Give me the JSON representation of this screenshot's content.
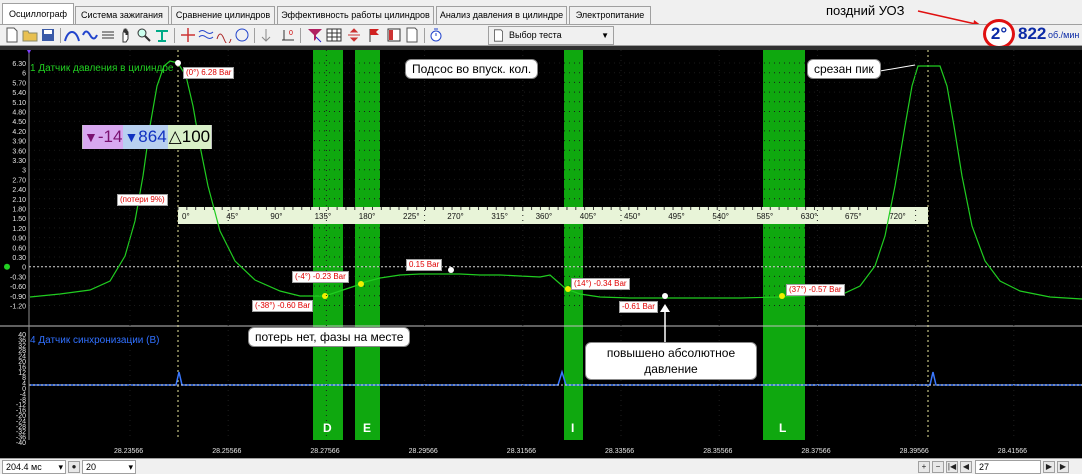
{
  "tabs": [
    {
      "label": "Осциллограф",
      "active": true
    },
    {
      "label": "Система зажигания",
      "active": false
    },
    {
      "label": "Сравнение цилиндров",
      "active": false
    },
    {
      "label": "Эффективность работы цилиндров",
      "active": false
    },
    {
      "label": "Анализ давления в цилиндре",
      "active": false
    },
    {
      "label": "Электропитание",
      "active": false
    }
  ],
  "annotation_top": "поздний УОЗ",
  "toolbar": {
    "test_select": "Выбор теста",
    "ignition_angle": "2°",
    "rpm_value": "822",
    "rpm_unit": "об./мин"
  },
  "channel1": {
    "title": "1 Датчик давления в цилиндре",
    "color": "#22d022",
    "y_ticks": [
      "6.30",
      "6",
      "5.70",
      "5.40",
      "5.10",
      "4.80",
      "4.50",
      "4.20",
      "3.90",
      "3.60",
      "3.30",
      "3",
      "2.70",
      "2.40",
      "2.10",
      "1.80",
      "1.50",
      "1.20",
      "0.90",
      "0.60",
      "0.30",
      "0",
      "-0.30",
      "-0.60",
      "-0.90",
      "-1.20"
    ]
  },
  "channel4": {
    "title": "4 Датчик синхронизации (В)",
    "color": "#3070ff",
    "y_ticks": [
      "40",
      "36",
      "32",
      "28",
      "24",
      "20",
      "16",
      "12",
      "8",
      "4",
      "0",
      "-4",
      "-8",
      "-12",
      "-16",
      "-20",
      "-24",
      "-28",
      "-32",
      "-36",
      "-40"
    ]
  },
  "cursor_readout": {
    "a": "-14",
    "b": "864",
    "c": "100"
  },
  "angle_ticks": [
    "0°",
    "45°",
    "90°",
    "135°",
    "180°",
    "225°",
    "270°",
    "315°",
    "360°",
    "405°",
    "450°",
    "495°",
    "540°",
    "585°",
    "630°",
    "675°",
    "720°"
  ],
  "time_ticks": [
    "28.23566",
    "28.25566",
    "28.27566",
    "28.29566",
    "28.31566",
    "28.33566",
    "28.35566",
    "28.37566",
    "28.39566",
    "28.41566"
  ],
  "markers": {
    "peak": "(0°) 6.28 Bar",
    "loss": "(потери 9%)",
    "m1": "(-38°) -0.60 Bar",
    "m2": "(-4°) -0.23 Bar",
    "m3": "0.15 Bar",
    "m4": "(14°) -0.34 Bar",
    "m5": "-0.61 Bar",
    "m6": "(37°) -0.57 Bar"
  },
  "notes": {
    "intake_leak": "Подсос во впуск. кол.",
    "peak_cut": "срезан пик",
    "no_loss": "потерь нет, фазы на месте",
    "abs_pressure": "повышено абсолютное давление"
  },
  "zones": [
    "D",
    "E",
    "I",
    "L"
  ],
  "statusbar": {
    "timebase": "204.4 мс",
    "count": "20",
    "page": "27"
  }
}
